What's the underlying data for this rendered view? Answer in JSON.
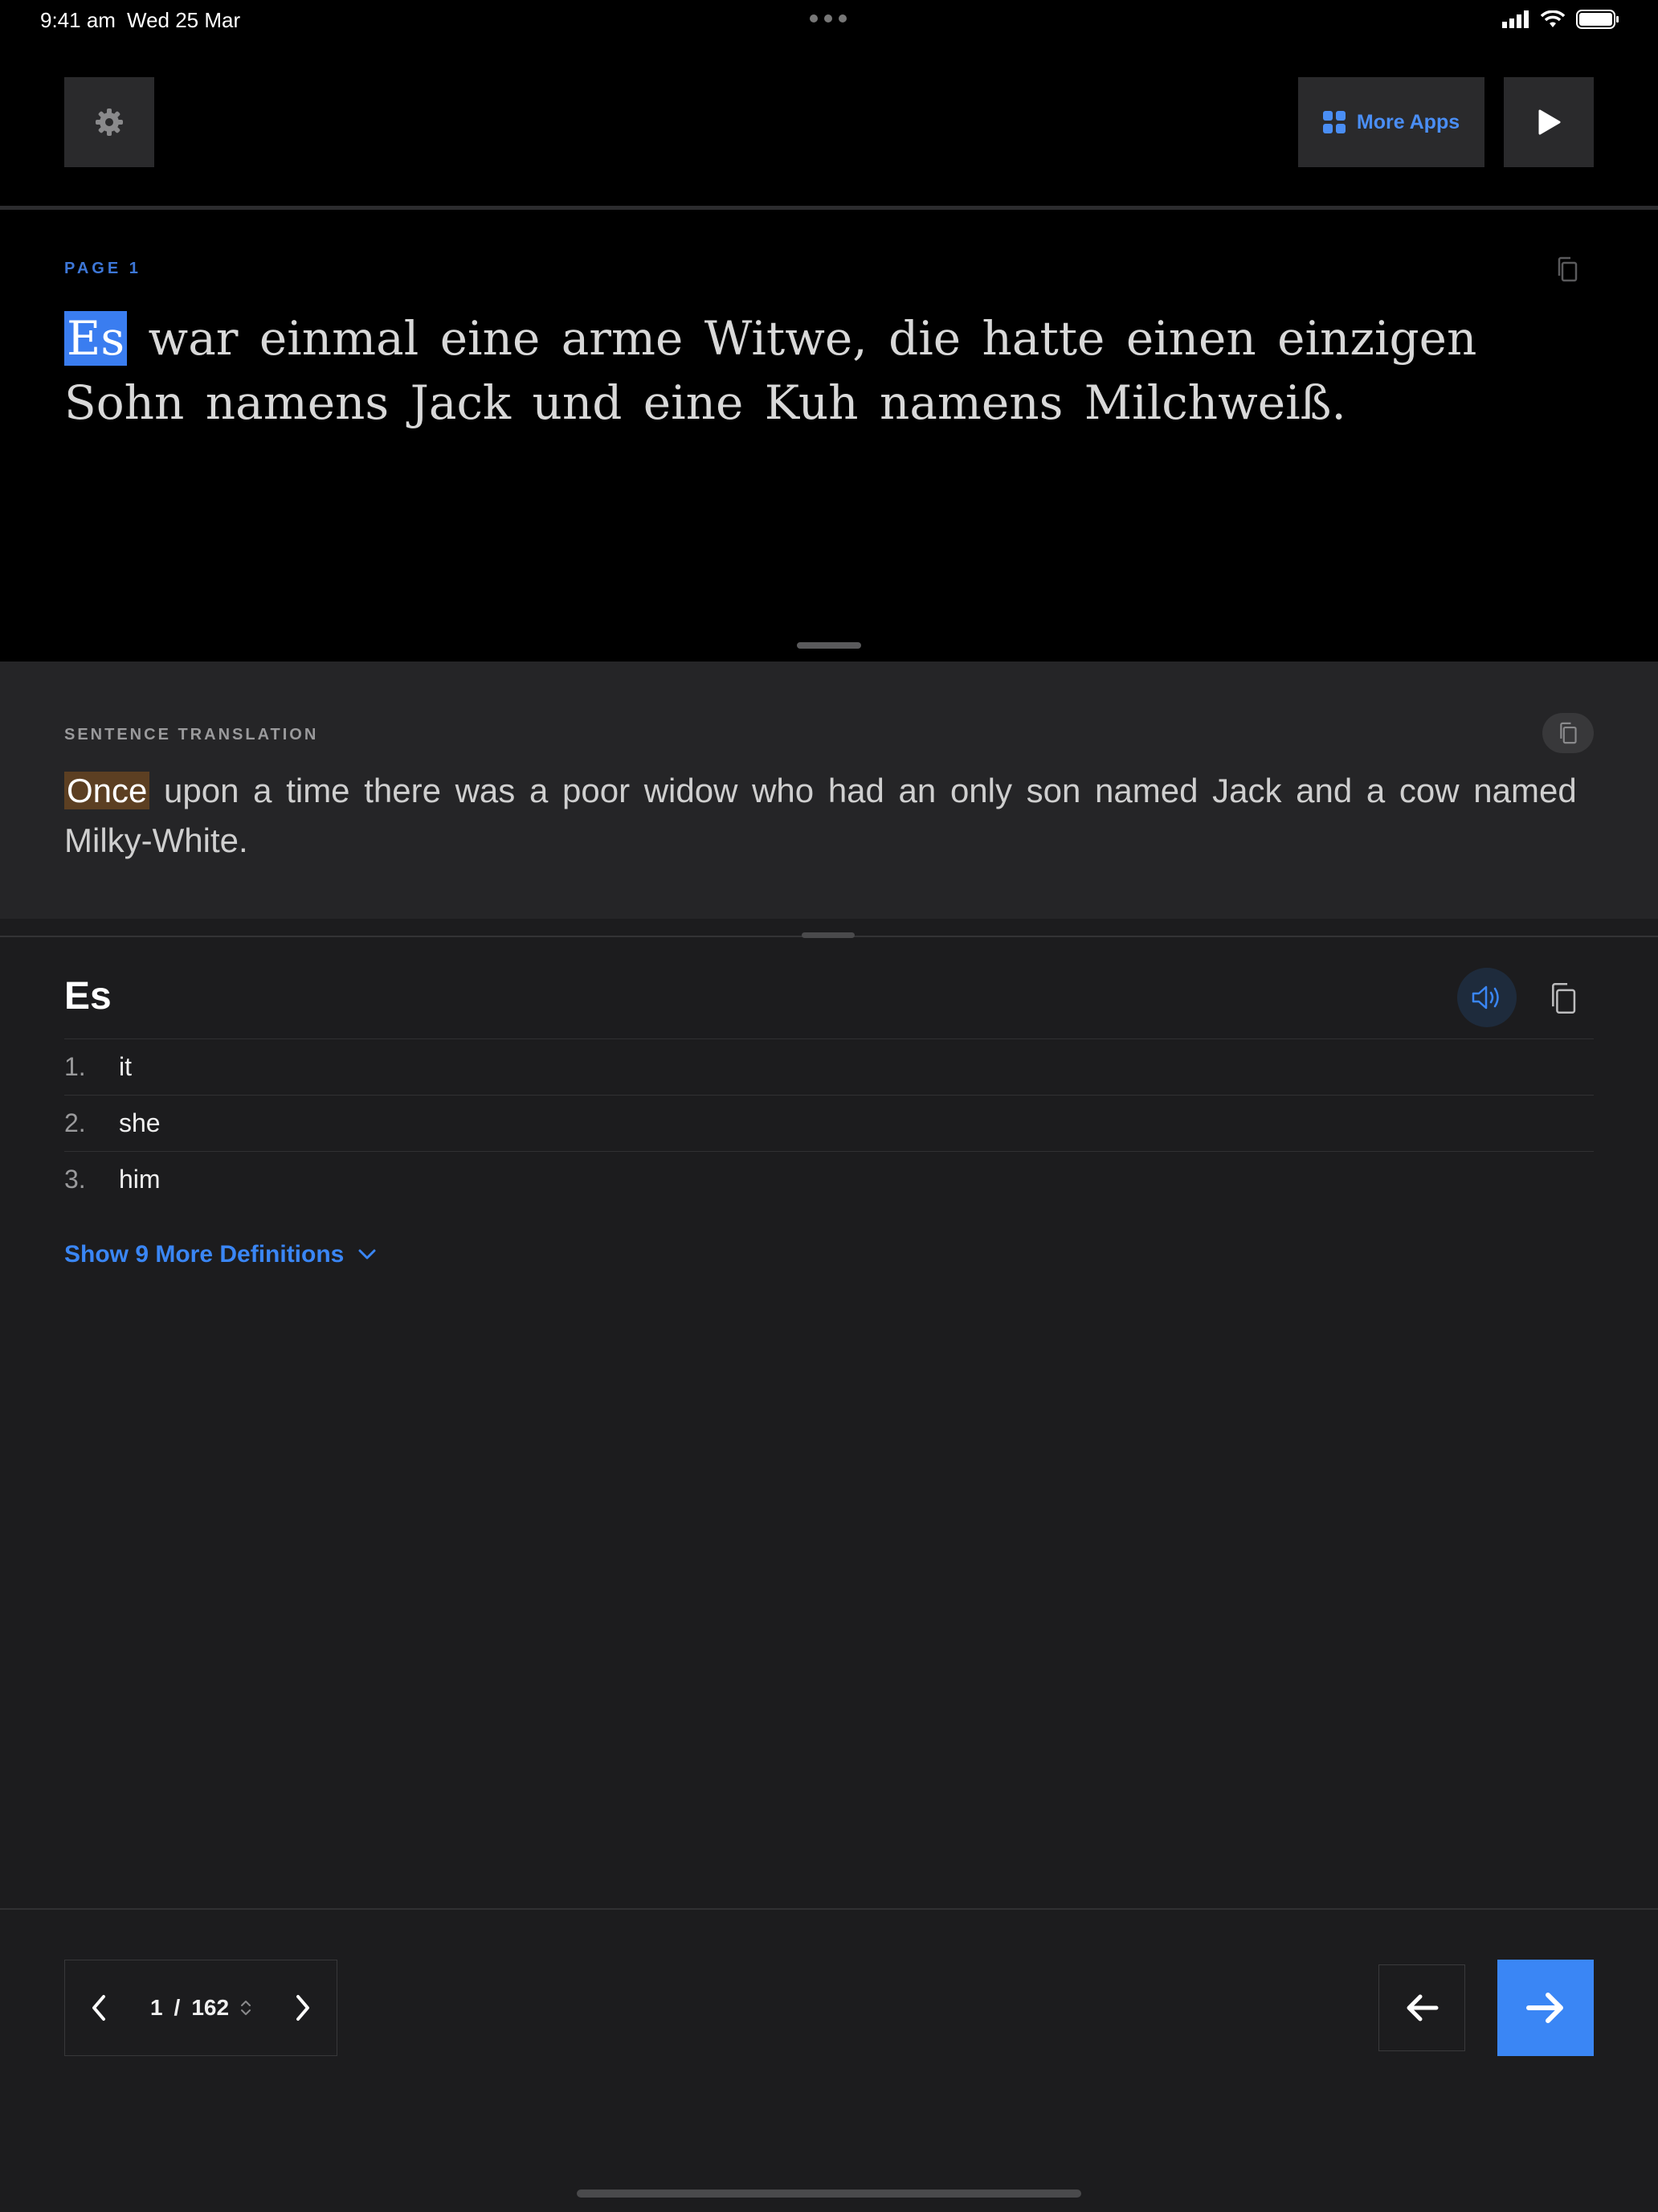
{
  "status_bar": {
    "time": "9:41 am",
    "date": "Wed 25 Mar"
  },
  "toolbar": {
    "more_apps_label": "More Apps",
    "icons": [
      "gear-icon",
      "grid-icon",
      "play-icon"
    ],
    "accent_color": "#4a8ef5"
  },
  "reader": {
    "page_label": "PAGE 1",
    "highlighted_word": "Es",
    "rest_text": " war einmal eine arme Witwe, die hatte einen einzigen Sohn namens Jack und eine Kuh namens Milchweiß."
  },
  "translation": {
    "label": "SENTENCE TRANSLATION",
    "highlighted_word": "Once",
    "rest_text": " upon a time there was a poor widow who had an only son named Jack and a cow named Milky-White."
  },
  "definition": {
    "word": "Es",
    "items": [
      {
        "num": "1.",
        "text": "it"
      },
      {
        "num": "2.",
        "text": "she"
      },
      {
        "num": "3.",
        "text": "him"
      }
    ],
    "show_more_label": "Show 9 More Definitions"
  },
  "pagination": {
    "current": "1",
    "separator": "/",
    "total": "162"
  },
  "colors": {
    "word_highlight": "#3a7df0",
    "translation_highlight": "#5c3f22",
    "primary_button": "#3a86f5"
  }
}
